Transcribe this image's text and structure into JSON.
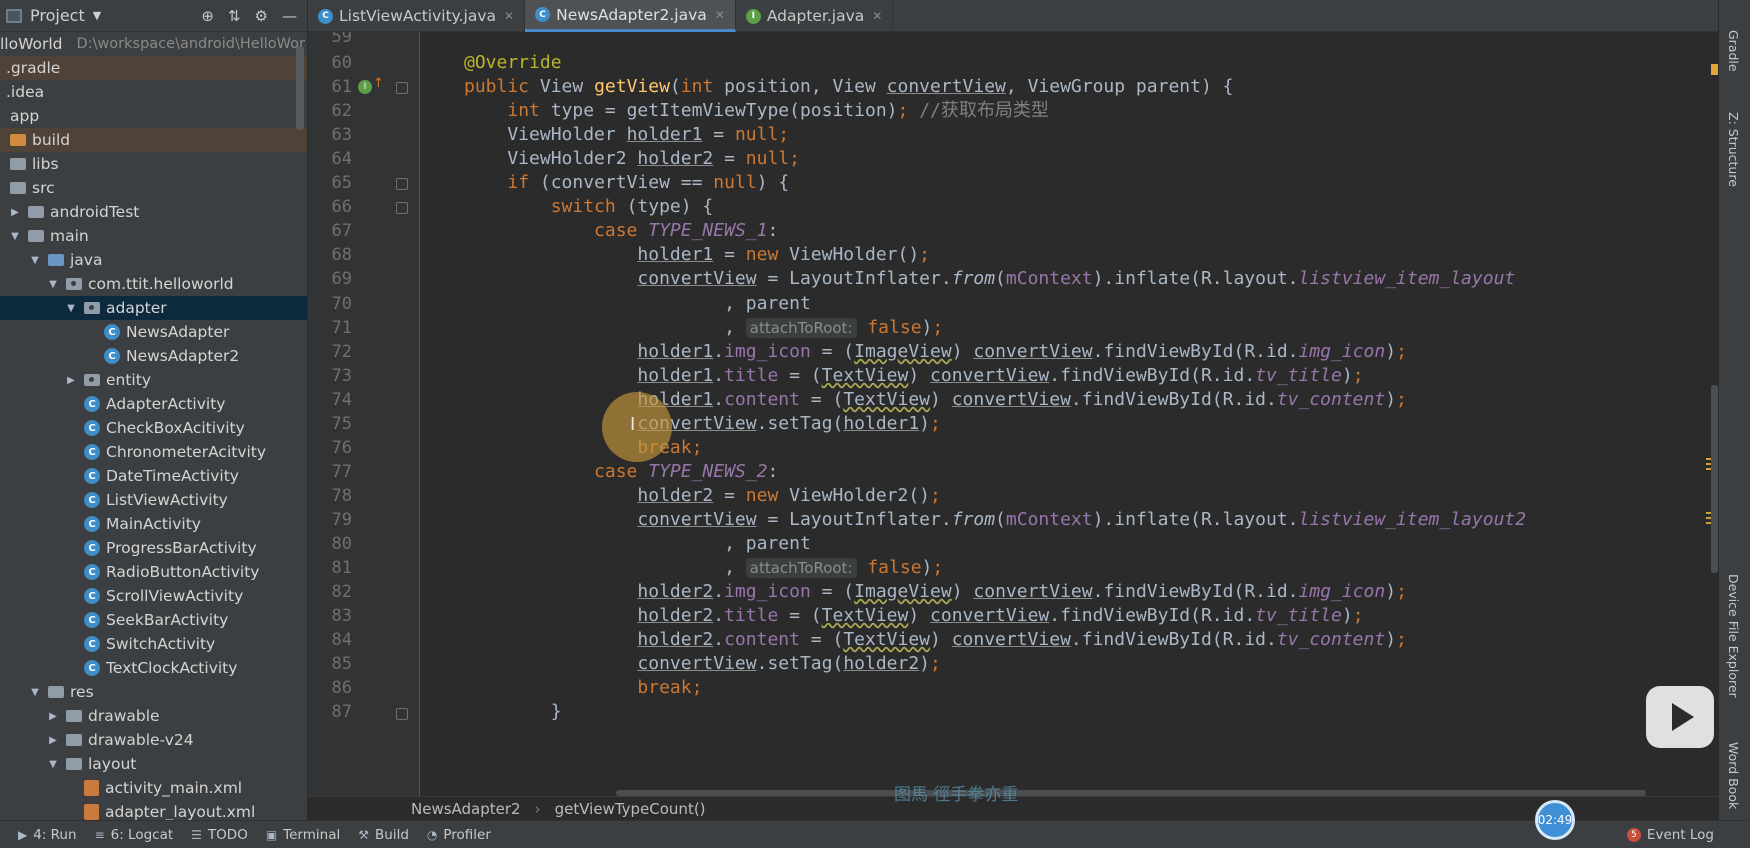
{
  "project_panel": {
    "title": "Project",
    "root": {
      "name": "lloWorld",
      "path": "D:\\workspace\\android\\HelloWor"
    },
    "tree": [
      {
        "label": ".gradle",
        "icon": "folder-icon"
      },
      {
        "label": ".idea",
        "icon": "folder-icon"
      },
      {
        "label": "app",
        "icon": "folder-icon"
      },
      {
        "label": "build",
        "icon": "folder-orange-icon"
      },
      {
        "label": "libs",
        "icon": "folder-icon"
      },
      {
        "label": "src",
        "icon": "folder-icon"
      },
      {
        "label": "androidTest",
        "icon": "folder-icon"
      },
      {
        "label": "main",
        "icon": "folder-icon"
      },
      {
        "label": "java",
        "icon": "folder-blue-icon"
      },
      {
        "label": "com.ttit.helloworld",
        "icon": "package-icon"
      },
      {
        "label": "adapter",
        "icon": "package-icon"
      },
      {
        "label": "NewsAdapter",
        "icon": "class-icon"
      },
      {
        "label": "NewsAdapter2",
        "icon": "class-icon"
      },
      {
        "label": "entity",
        "icon": "package-icon"
      },
      {
        "label": "AdapterActivity",
        "icon": "class-icon"
      },
      {
        "label": "CheckBoxAcitivity",
        "icon": "class-icon"
      },
      {
        "label": "ChronometerAcitvity",
        "icon": "class-icon"
      },
      {
        "label": "DateTimeActivity",
        "icon": "class-icon"
      },
      {
        "label": "ListViewActivity",
        "icon": "class-icon"
      },
      {
        "label": "MainActivity",
        "icon": "class-icon"
      },
      {
        "label": "ProgressBarActivity",
        "icon": "class-icon"
      },
      {
        "label": "RadioButtonActivity",
        "icon": "class-icon"
      },
      {
        "label": "ScrollViewActivity",
        "icon": "class-icon"
      },
      {
        "label": "SeekBarActivity",
        "icon": "class-icon"
      },
      {
        "label": "SwitchActivity",
        "icon": "class-icon"
      },
      {
        "label": "TextClockActivity",
        "icon": "class-icon"
      },
      {
        "label": "res",
        "icon": "folder-icon"
      },
      {
        "label": "drawable",
        "icon": "folder-icon"
      },
      {
        "label": "drawable-v24",
        "icon": "folder-icon"
      },
      {
        "label": "layout",
        "icon": "folder-icon"
      },
      {
        "label": "activity_main.xml",
        "icon": "xml-file-icon"
      },
      {
        "label": "adapter_layout.xml",
        "icon": "xml-file-icon"
      }
    ]
  },
  "tabs": [
    {
      "label": "ListViewActivity.java",
      "active": false
    },
    {
      "label": "NewsAdapter2.java",
      "active": true
    },
    {
      "label": "Adapter.java",
      "active": false
    }
  ],
  "editor": {
    "line_numbers": [
      "59",
      "60",
      "61",
      "62",
      "63",
      "64",
      "65",
      "66",
      "67",
      "68",
      "69",
      "70",
      "71",
      "72",
      "73",
      "74",
      "75",
      "76",
      "77",
      "78",
      "79",
      "80",
      "81",
      "82",
      "83",
      "84",
      "85",
      "86",
      "87"
    ],
    "hint_attach": "attachToRoot:"
  },
  "breadcrumb": [
    "NewsAdapter2",
    "getViewTypeCount()"
  ],
  "watermark": "图馬 徑手拳亦重",
  "right_tools": [
    "Gradle",
    "Z: Structure",
    "Device File Explorer",
    "Word Book"
  ],
  "status_bar": {
    "items": [
      "4: Run",
      "6: Logcat",
      "TODO",
      "Terminal",
      "Build",
      "Profiler"
    ],
    "event_log": "Event Log",
    "timer": "02:49"
  },
  "colors": {
    "background": "#2b2b2b",
    "panel": "#3c3f41",
    "keyword": "#cc7832",
    "method": "#ffc66d",
    "field": "#9876aa",
    "annotation": "#bbb529",
    "selection": "#0d293e"
  }
}
